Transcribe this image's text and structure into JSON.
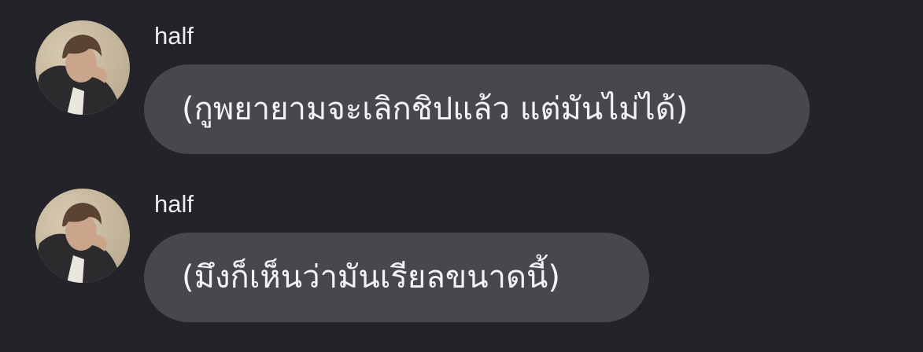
{
  "chat": {
    "messages": [
      {
        "sender": "half",
        "avatar_icon": "user-photo-avatar",
        "text": "(กูพยายามจะเลิกชิปแล้ว แต่มันไม่ได้)"
      },
      {
        "sender": "half",
        "avatar_icon": "user-photo-avatar",
        "text": "(มึงก็เห็นว่ามันเรียลขนาดนี้)"
      }
    ]
  },
  "colors": {
    "background": "#232329",
    "bubble": "#47484e",
    "text": "#f3f3f6"
  }
}
